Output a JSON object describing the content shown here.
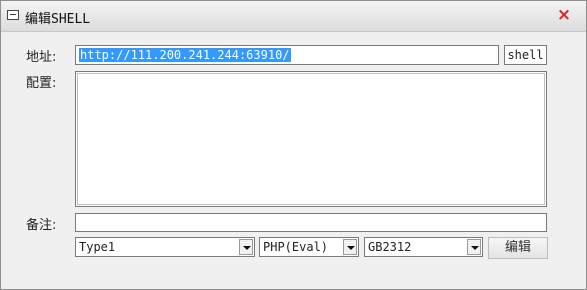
{
  "window": {
    "title": "编辑SHELL",
    "close_glyph": "×"
  },
  "form": {
    "address_label": "地址:",
    "address_value": "http://111.200.241.244:63910/",
    "shell_button": "shell",
    "config_label": "配置:",
    "config_value": "",
    "note_label": "备注:",
    "note_value": "",
    "type_select": "Type1",
    "script_select": "PHP(Eval)",
    "encoding_select": "GB2312",
    "edit_button": "编辑"
  },
  "colors": {
    "selection": "#3399ff",
    "close": "#d8262a"
  },
  "icons": [
    "window-icon",
    "close-icon",
    "dropdown-arrow-icon"
  ]
}
